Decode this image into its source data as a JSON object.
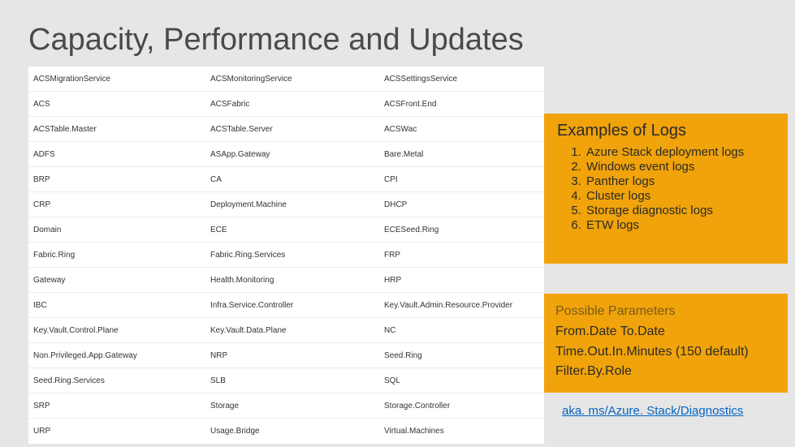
{
  "title": "Capacity, Performance and Updates",
  "table": {
    "rows": [
      [
        "ACSMigrationService",
        "ACSMonitoringService",
        "ACSSettingsService"
      ],
      [
        "ACS",
        "ACSFabric",
        "ACSFront.End"
      ],
      [
        "ACSTable.Master",
        "ACSTable.Server",
        "ACSWac"
      ],
      [
        "ADFS",
        "ASApp.Gateway",
        "Bare.Metal"
      ],
      [
        "BRP",
        "CA",
        "CPI"
      ],
      [
        "CRP",
        "Deployment.Machine",
        "DHCP"
      ],
      [
        "Domain",
        "ECE",
        "ECESeed.Ring"
      ],
      [
        "Fabric.Ring",
        "Fabric.Ring.Services",
        "FRP"
      ],
      [
        "Gateway",
        "Health.Monitoring",
        "HRP"
      ],
      [
        "IBC",
        "Infra.Service.Controller",
        "Key.Vault.Admin.Resource.Provider"
      ],
      [
        "Key.Vault.Control.Plane",
        "Key.Vault.Data.Plane",
        "NC"
      ],
      [
        "Non.Privileged.App.Gateway",
        "NRP",
        "Seed.Ring"
      ],
      [
        "Seed.Ring.Services",
        "SLB",
        "SQL"
      ],
      [
        "SRP",
        "Storage",
        "Storage.Controller"
      ],
      [
        "URP",
        "Usage.Bridge",
        "Virtual.Machines"
      ]
    ]
  },
  "examples": {
    "title": "Examples of Logs",
    "items": [
      "Azure Stack deployment logs",
      "Windows event logs",
      "Panther logs",
      "Cluster logs",
      "Storage diagnostic logs",
      "ETW logs"
    ]
  },
  "params": {
    "title": "Possible Parameters",
    "lines": [
      "From.Date To.Date",
      "Time.Out.In.Minutes (150 default)",
      "Filter.By.Role"
    ]
  },
  "link": "aka. ms/Azure. Stack/Diagnostics"
}
